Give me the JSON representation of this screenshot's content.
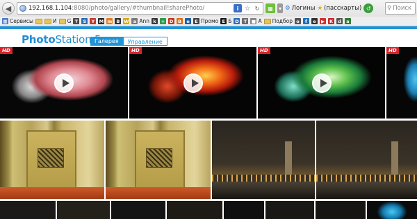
{
  "browser": {
    "url_host": "192.168.1.104",
    "url_path": ":8080/photo/gallery/#thumbnail!sharePhoto/",
    "logins_label": "Логины",
    "passcards_label": "(пасскарты)",
    "search_placeholder": "Поиск"
  },
  "bookmarks": [
    {
      "label": "Сервисы",
      "icon": "apps-icon"
    },
    {
      "label": "И",
      "icon": "folder-icon"
    },
    {
      "label": "G",
      "icon": "folder-icon"
    },
    {
      "label": "Ann",
      "icon": "folder-icon"
    },
    {
      "label": "Промо",
      "icon": "promo-icon"
    },
    {
      "label": "Б",
      "icon": "bookmark-icon"
    },
    {
      "label": "А",
      "icon": "bookmark-icon"
    },
    {
      "label": "Подбор",
      "icon": "folder-icon"
    }
  ],
  "app": {
    "logo_bold": "Photo",
    "logo_rest": "Station 5",
    "tabs": [
      "Галерея",
      "Управление"
    ]
  },
  "gallery": {
    "video_badge": "HD"
  },
  "colors": {
    "accent": "#1f94d7",
    "hd_badge": "#d8232a"
  }
}
